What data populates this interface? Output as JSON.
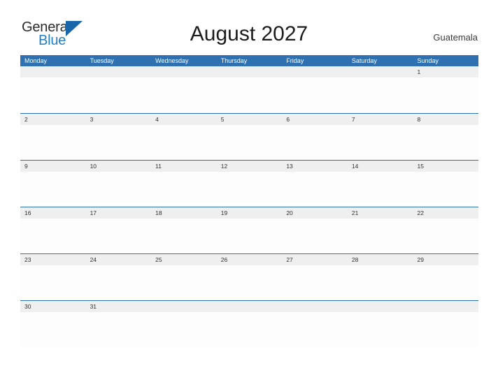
{
  "brand": {
    "name_part1": "General",
    "name_part2": "Blue",
    "flag_icon": "blue-triangle-flag",
    "colors": {
      "text_dark": "#2b2b2b",
      "blue": "#1f7ec4",
      "flag": "#1966ab"
    }
  },
  "header": {
    "title": "August 2027",
    "country": "Guatemala"
  },
  "calendar": {
    "colors": {
      "header_blue": "#2e70b0",
      "date_strip_gray": "#efefef",
      "separator_blue": "#2e70b0",
      "cell_white": "#fdfdfd"
    },
    "weekday_headers": [
      "Monday",
      "Tuesday",
      "Wednesday",
      "Thursday",
      "Friday",
      "Saturday",
      "Sunday"
    ],
    "weeks": [
      [
        "",
        "",
        "",
        "",
        "",
        "",
        "1"
      ],
      [
        "2",
        "3",
        "4",
        "5",
        "6",
        "7",
        "8"
      ],
      [
        "9",
        "10",
        "11",
        "12",
        "13",
        "14",
        "15"
      ],
      [
        "16",
        "17",
        "18",
        "19",
        "20",
        "21",
        "22"
      ],
      [
        "23",
        "24",
        "25",
        "26",
        "27",
        "28",
        "29"
      ],
      [
        "30",
        "31",
        "",
        "",
        "",
        "",
        ""
      ]
    ]
  }
}
